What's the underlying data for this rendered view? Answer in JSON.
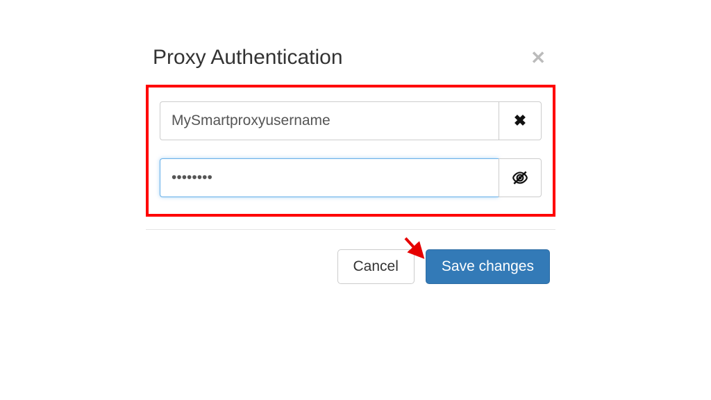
{
  "modal": {
    "title": "Proxy Authentication",
    "username": {
      "value": "MySmartproxyusername"
    },
    "password": {
      "value": "••••••••"
    },
    "cancel_label": "Cancel",
    "save_label": "Save changes"
  }
}
